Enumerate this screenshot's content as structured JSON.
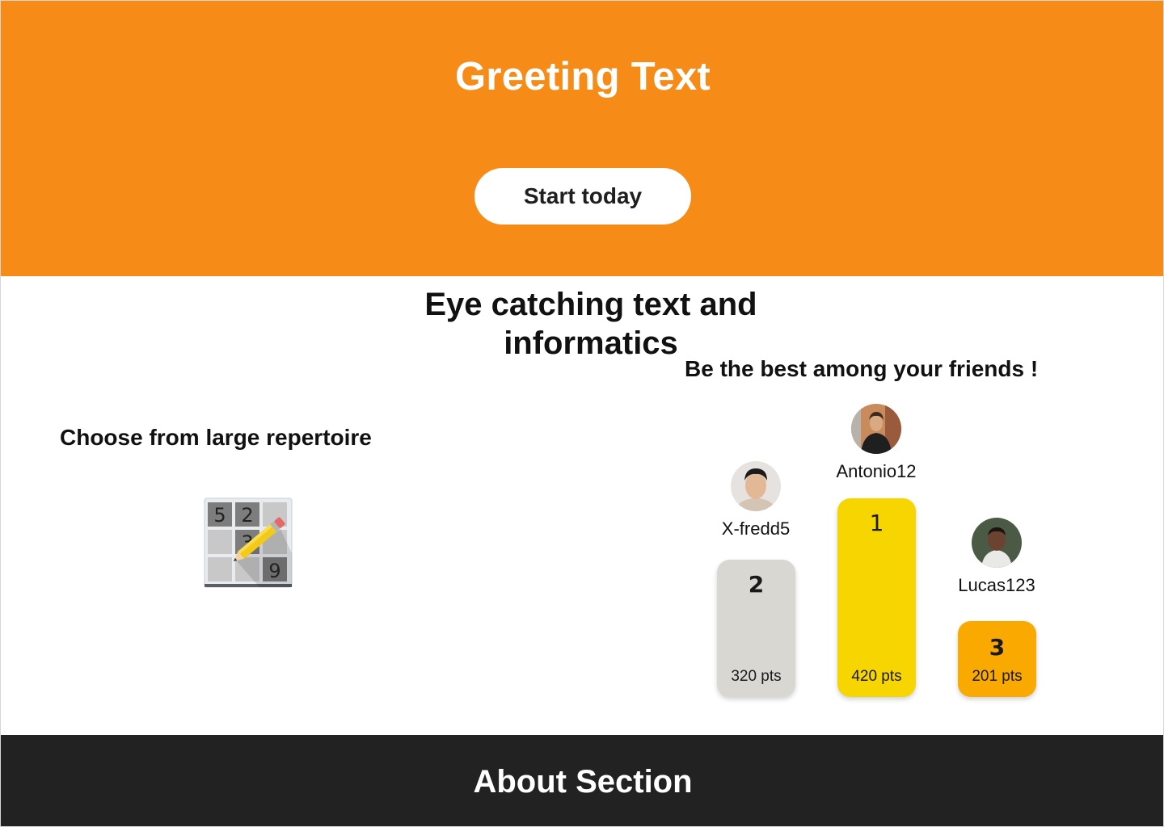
{
  "hero": {
    "title": "Greeting Text",
    "cta_label": "Start today",
    "background": "#f78b17"
  },
  "main": {
    "headline": "Eye catching text and informatics",
    "repertoire_heading": "Choose from large  repertoire",
    "friends_heading": "Be the best among your friends !"
  },
  "sudoku": {
    "icon": "sudoku-pencil-icon",
    "digits": [
      "5",
      "2",
      "3",
      "9"
    ]
  },
  "leaderboard": [
    {
      "rank": "2",
      "username": "X-fredd5",
      "points": "320 pts",
      "color": "#d9d7d2"
    },
    {
      "rank": "1",
      "username": "Antonio12",
      "points": "420 pts",
      "color": "#f7d500"
    },
    {
      "rank": "3",
      "username": "Lucas123",
      "points": "201 pts",
      "color": "#f9a900"
    }
  ],
  "about": {
    "title": "About Section",
    "background": "#222222"
  }
}
